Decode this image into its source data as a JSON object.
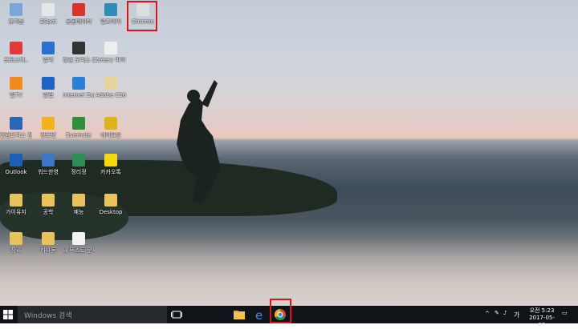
{
  "desktop": {
    "icons": [
      {
        "label": "휴지통",
        "color": "#7aa7d8"
      },
      {
        "label": "ESpot",
        "color": "#e6e6e6"
      },
      {
        "label": "공공데이터",
        "color": "#d9342b"
      },
      {
        "label": "알프아이",
        "color": "#2d8fb5"
      },
      {
        "label": "Chrome",
        "color": "#ddd"
      },
      {
        "label": "포토스케..",
        "color": "#e23b3b"
      },
      {
        "label": "알약",
        "color": "#2a6fd1"
      },
      {
        "label": "한컴 오피스 한글계",
        "color": "#333"
      },
      {
        "label": "Zotery 파이 체계",
        "color": "#eee"
      },
      {
        "label": "알TV",
        "color": "#f08a1c"
      },
      {
        "label": "알캡",
        "color": "#1b64c4"
      },
      {
        "label": "Internet Explorer",
        "color": "#2b7fd4"
      },
      {
        "label": "Adobe CS6",
        "color": "#e6d49a"
      },
      {
        "label": "한컴오피스 한글 2014",
        "color": "#2a66b8"
      },
      {
        "label": "정보편",
        "color": "#f2b21b"
      },
      {
        "label": "Evernote",
        "color": "#2f8f3a"
      },
      {
        "label": "네이트온",
        "color": "#e0b21a"
      },
      {
        "label": "Outlook",
        "color": "#1d5fb5"
      },
      {
        "label": "워드한영",
        "color": "#3c76c8"
      },
      {
        "label": "정리정",
        "color": "#2e8f56"
      },
      {
        "label": "카카오톡",
        "color": "#f5d90a"
      },
      {
        "label": "가이유지",
        "color": "#e8c25a"
      },
      {
        "label": "공학",
        "color": "#e8c25a"
      },
      {
        "label": "예능",
        "color": "#e8c25a"
      },
      {
        "label": "Desktop",
        "color": "#e8c25a"
      },
      {
        "label": "장사",
        "color": "#e8c25a"
      },
      {
        "label": "하나동",
        "color": "#e8c25a"
      },
      {
        "label": "새 텍스트 문서",
        "color": "#f2f2f2"
      }
    ]
  },
  "taskbar": {
    "search_placeholder": "Windows 검색",
    "ime": "가",
    "time": "오전 5:23",
    "date": "2017-05-09"
  }
}
